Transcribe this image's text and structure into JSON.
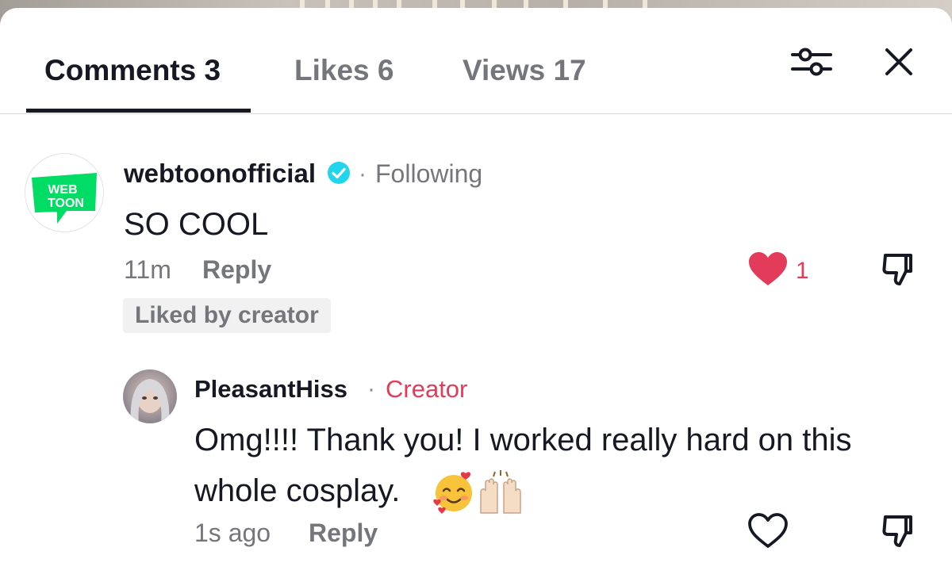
{
  "tabs": [
    {
      "label": "Comments 3",
      "active": true
    },
    {
      "label": "Likes 6",
      "active": false
    },
    {
      "label": "Views 17",
      "active": false
    }
  ],
  "header_icons": {
    "filter": "sliders-icon",
    "close": "close-icon"
  },
  "comments": [
    {
      "avatar_logo_text": [
        "WEB",
        "TOON"
      ],
      "username": "webtoonofficial",
      "verified": true,
      "relation": "Following",
      "text": "SO COOL",
      "time": "11m",
      "reply_label": "Reply",
      "like_count": "1",
      "liked": true,
      "badge": "Liked by creator"
    },
    {
      "username": "PleasantHiss",
      "role": "Creator",
      "text_line1": "Omg!!!! Thank you! I worked really hard on this",
      "text_line2": "whole cosplay.",
      "emojis": [
        "smiling-face-with-hearts",
        "raising-hands"
      ],
      "time": "1s ago",
      "reply_label": "Reply",
      "liked": false
    }
  ],
  "colors": {
    "accent": "#e23c5a",
    "verified": "#20d5ec",
    "webtoon_green": "#00dc64"
  }
}
